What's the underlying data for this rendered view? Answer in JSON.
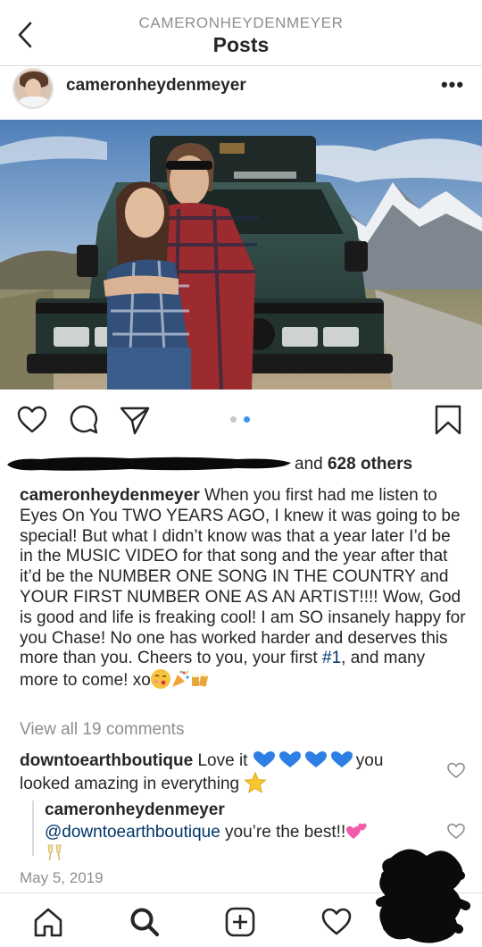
{
  "header": {
    "owner": "CAMERONHEYDENMEYER",
    "title": "Posts"
  },
  "post": {
    "username": "cameronheydenmeyer",
    "more_label": "•••",
    "carousel": {
      "count": 2,
      "active_index": 1
    },
    "likes_suffix_prefix": "and ",
    "likes_others": "628 others",
    "caption": {
      "username": "cameronheydenmeyer",
      "text_part1": " When you first had me listen to Eyes On You TWO YEARS AGO, I knew it was going to be special! But what I didn’t know was that a year later I’d be in the MUSIC VIDEO for that song and the year after that it’d be the NUMBER ONE SONG IN THE COUNTRY and YOUR FIRST NUMBER ONE AS AN ARTIST!!!! Wow, God is good and life is freaking cool! I am SO insanely happy for you Chase! No one has worked harder and deserves this more than you. Cheers to you, your first ",
      "hashtag": "#1",
      "text_part2": ", and many more to come! xo"
    },
    "view_comments": "View all 19 comments",
    "comments": [
      {
        "username": "downtoearthboutique",
        "text_before": " Love it ",
        "text_after": "you looked amazing in everything "
      }
    ],
    "reply": {
      "username": "cameronheydenmeyer",
      "mention": "@downtoearthboutique",
      "text": " you’re the best!!"
    },
    "date": "May 5, 2019"
  },
  "icons": {
    "back": "chevron-left-icon",
    "like": "heart-outline-icon",
    "comment": "comment-bubble-icon",
    "share": "paper-plane-icon",
    "save": "bookmark-icon",
    "home": "home-icon",
    "search": "search-icon",
    "add": "add-post-icon",
    "activity": "heart-activity-icon"
  },
  "colors": {
    "text": "#262626",
    "muted": "#8e8e8e",
    "link": "#003569",
    "accent": "#3897f0",
    "divider": "#dbdbdb"
  }
}
